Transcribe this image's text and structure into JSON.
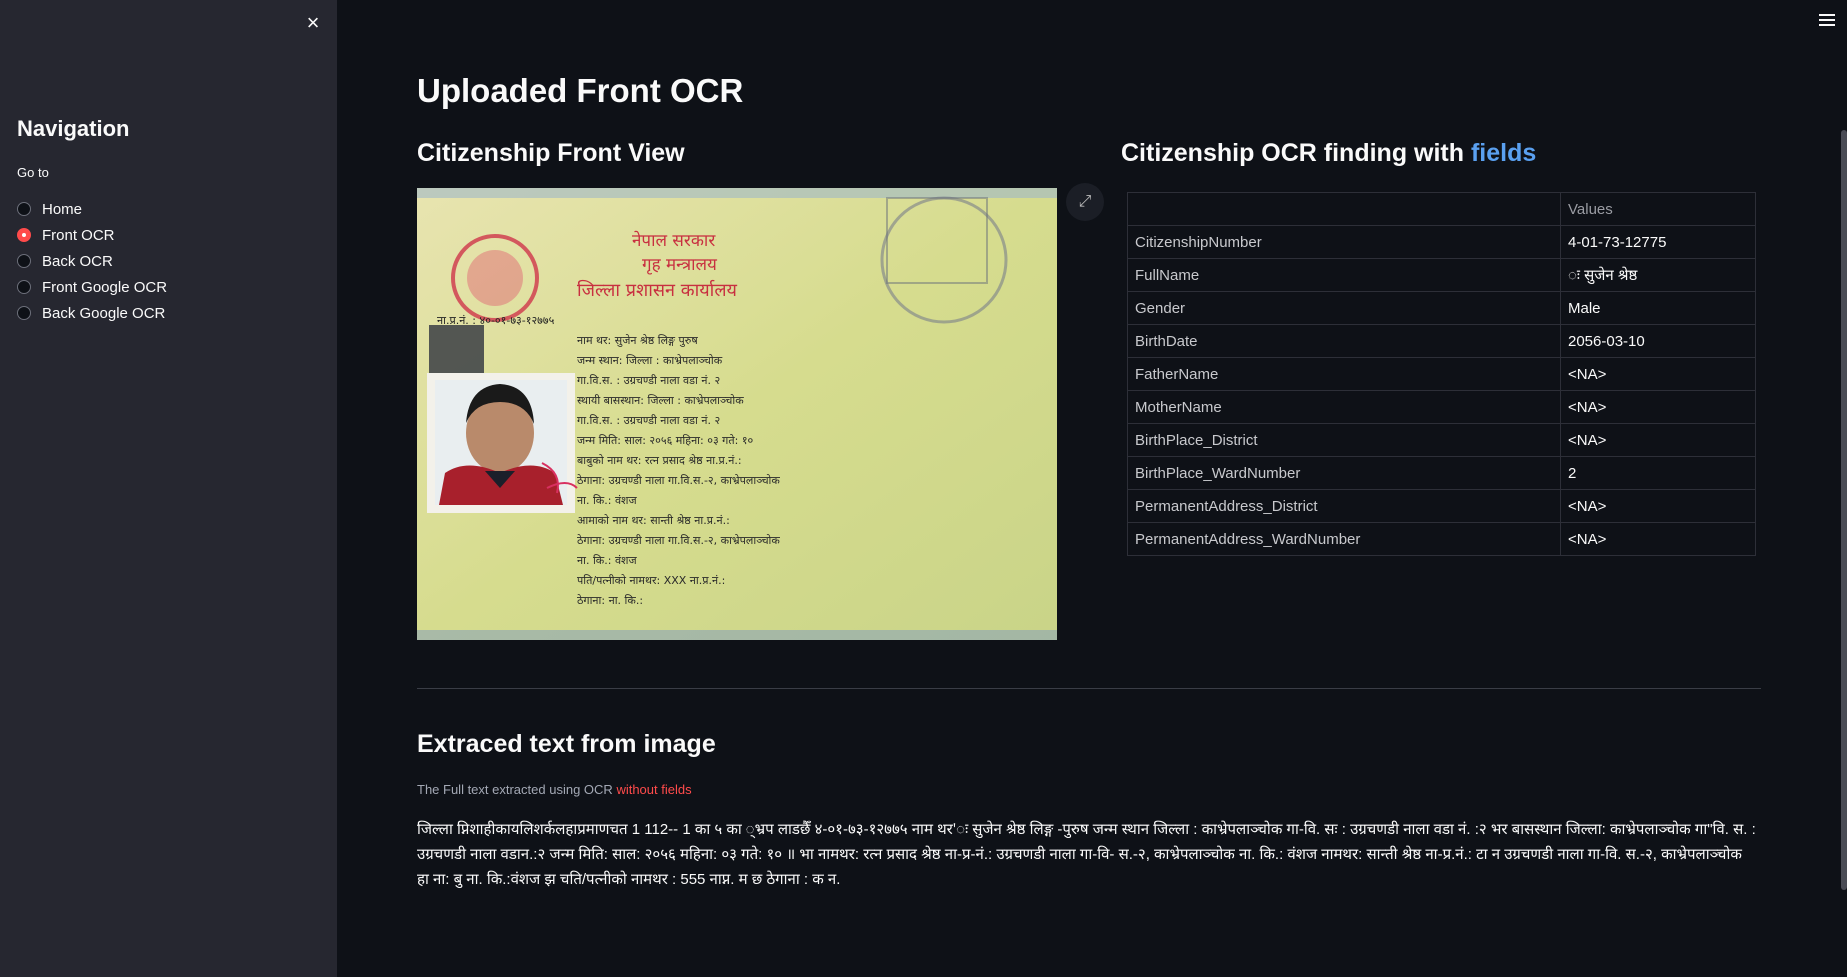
{
  "sidebar": {
    "title": "Navigation",
    "goto_label": "Go to",
    "options": [
      "Home",
      "Front OCR",
      "Back OCR",
      "Front Google OCR",
      "Back Google OCR"
    ],
    "selected": "Front OCR",
    "close_icon": "×"
  },
  "main": {
    "title": "Uploaded Front OCR",
    "left_subtitle": "Citizenship Front View",
    "right_subtitle_prefix": "Citizenship OCR finding with",
    "right_subtitle_accent": "fields",
    "expand_icon": "⤢",
    "table": {
      "header": [
        "",
        "Values"
      ],
      "rows": [
        [
          "CitizenshipNumber",
          "4-01-73-12775"
        ],
        [
          "FullName",
          "ः सुजेन श्रेष्ठ"
        ],
        [
          "Gender",
          "Male"
        ],
        [
          "BirthDate",
          "2056-03-10"
        ],
        [
          "FatherName",
          "<NA>"
        ],
        [
          "MotherName",
          "<NA>"
        ],
        [
          "BirthPlace_District",
          "<NA>"
        ],
        [
          "BirthPlace_WardNumber",
          "2"
        ],
        [
          "PermanentAddress_District",
          "<NA>"
        ],
        [
          "PermanentAddress_WardNumber",
          "<NA>"
        ]
      ]
    },
    "extract_title": "Extraced text from image",
    "caption_prefix": "The Full text extracted using OCR",
    "caption_red": "without fields",
    "full_text": "जिल्ला प्निशाहीकायलिशर्कलहाप्रमाणचत 1 112-- 1 का ५ का ्भ्रप लाडछैँ ४-०१-७३-१२७७५ नाम थर'ः सुजेन श्रेष्ठ लिङ्ग -पुरुष जन्म स्थान जिल्ला : काभ्रेपलाञ्चोक गा-वि. सः : उग्रचणडी नाला वडा नं. :२ भर बासस्थान जिल्ला: काभ्रेपलाञ्चोक गा\"वि. स. : उग्रचणडी नाला वडान.:२ जन्म मिति: साल: २०५६ महिना: ०३ गते: १० ॥ भा नामथर: रत्न प्रसाद श्रेष्ठ ना-प्र-नं.: उग्रचणडी नाला गा-वि- स.-२, काभ्रेपलाञ्चोक ना. कि.: वंशज नामथर: सान्ती श्रेष्ठ ना-प्र.नं.: टा न उग्रचणडी नाला गा-वि. स.-२, काभ्रेपलाञ्चोक हा ना: बु ना. कि.:वंशज झ चति/पत्नीको नामथर : 555 नाप्न. म छ ठेगाना : क न."
  },
  "card": {
    "gov_line1": "नेपाल सरकार",
    "gov_line2": "गृह मन्त्रालय",
    "gov_line3": "जिल्ला प्रशासन कार्यालय",
    "number": "ना.प्र.नं. : ४०-०१-७३-१२७७५",
    "lines": [
      "नाम थर: सुजेन श्रेष्ठ लिङ्ग पुरुष",
      "जन्म स्थान: जिल्ला : काभ्रेपलाञ्चोक",
      "गा.वि.स. : उग्रचण्डी नाला वडा नं. २",
      "स्थायी बासस्थान: जिल्ला : काभ्रेपलाञ्चोक",
      "गा.वि.स. : उग्रचण्डी नाला वडा नं. २",
      "जन्म मिति: साल: २०५६ महिना: ०३ गते: १०",
      "बाबुको नाम थर: रत्न प्रसाद श्रेष्ठ ना.प्र.नं.:",
      "ठेगाना: उग्रचण्डी नाला गा.वि.स.-२, काभ्रेपलाञ्चोक",
      "ना. कि.: वंशज",
      "आमाको नाम थर: सान्ती श्रेष्ठ ना.प्र.नं.:",
      "ठेगाना: उग्रचण्डी नाला गा.वि.स.-२, काभ्रेपलाञ्चोक",
      "ना. कि.: वंशज",
      "पति/पत्नीको नामथर: XXX ना.प्र.नं.:",
      "ठेगाना: ना. कि.:"
    ]
  }
}
